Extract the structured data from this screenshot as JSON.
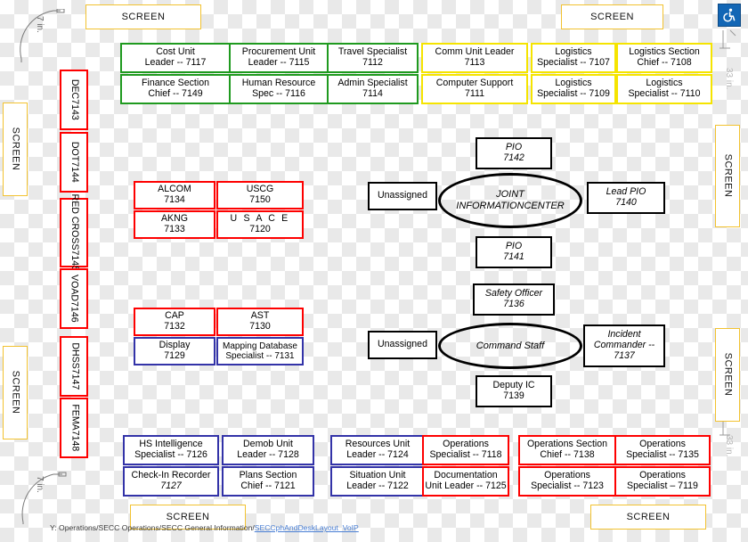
{
  "document": {
    "footer_path": "Y: Operations/SECC Operations/SECC General Information/",
    "footer_link": "SECCphAndDeskLayout_VoIP"
  },
  "colors": {
    "green": "#1f9a1f",
    "yellow": "#f5e400",
    "red": "#fe0000",
    "navy": "#3333a8",
    "black": "#000000",
    "screen_border": "#f2c230",
    "link": "#4a7fd4",
    "accessibility_blue": "#1266b5"
  },
  "screens": {
    "top_left": "SCREEN",
    "top_right": "SCREEN",
    "bottom_center": "SCREEN",
    "bottom_right": "SCREEN",
    "left_upper": "SCREEN",
    "left_lower": "SCREEN",
    "right_upper": "SCREEN",
    "right_lower": "SCREEN"
  },
  "dimensions": {
    "top_left": "7 in.",
    "bottom_left": "7 in.",
    "right_upper": "33 in.",
    "right_lower": "33 in."
  },
  "icons": {
    "accessibility": "wheelchair-accessible-icon"
  },
  "finance_section": {
    "border_color": "#1f9a1f",
    "boxes": [
      {
        "line1": "Cost Unit",
        "line2": "Leader -- 7117"
      },
      {
        "line1": "Procurement Unit",
        "line2": "Leader -- 7115"
      },
      {
        "line1": "Travel Specialist",
        "line2": "7112"
      },
      {
        "line1": "Finance Section",
        "line2": "Chief -- 7149"
      },
      {
        "line1": "Human Resource",
        "line2": "Spec -- 7116"
      },
      {
        "line1": "Admin Specialist",
        "line2": "7114"
      }
    ]
  },
  "logistics_section": {
    "border_color": "#f5e400",
    "boxes": [
      {
        "line1": "Comm Unit Leader",
        "line2": "7113"
      },
      {
        "line1": "Logistics",
        "line2": "Specialist -- 7107"
      },
      {
        "line1": "Logistics Section",
        "line2": "Chief -- 7108"
      },
      {
        "line1": "Computer Support",
        "line2": "7111"
      },
      {
        "line1": "Logistics",
        "line2": "Specialist -- 7109"
      },
      {
        "line1": "Logistics",
        "line2": "Specialist -- 7110"
      }
    ]
  },
  "agency_column": {
    "border_color": "#fe0000",
    "boxes": [
      {
        "line1": "DEC",
        "line2": "7143"
      },
      {
        "line1": "DOT",
        "line2": "7144"
      },
      {
        "line1": "RED CROSS",
        "line2": "7145"
      },
      {
        "line1": "VOAD",
        "line2": "7146"
      },
      {
        "line1": "DHSS",
        "line2": "7147"
      },
      {
        "line1": "FEMA",
        "line2": "7148"
      }
    ]
  },
  "agency_group_upper": {
    "border_color": "#fe0000",
    "boxes": [
      {
        "line1": "ALCOM",
        "line2": "7134"
      },
      {
        "line1": "USCG",
        "line2": "7150"
      },
      {
        "line1": "AKNG",
        "line2": "7133"
      },
      {
        "line1": "U S A C E",
        "line2": "7120"
      }
    ]
  },
  "agency_group_lower": {
    "boxes": [
      {
        "line1": "CAP",
        "line2": "7132",
        "border_color": "#fe0000"
      },
      {
        "line1": "AST",
        "line2": "7130",
        "border_color": "#fe0000"
      },
      {
        "line1": "Display",
        "line2": "7129",
        "border_color": "#3333a8"
      },
      {
        "line1": "Mapping Database",
        "line2": "Specialist -- 7131",
        "border_color": "#3333a8"
      }
    ]
  },
  "joint_information_center": {
    "hub_line1": "JOINT INFORMATION",
    "hub_line2": "CENTER",
    "top": {
      "line1": "PIO",
      "line2": "7142"
    },
    "bottom": {
      "line1": "PIO",
      "line2": "7141"
    },
    "left": {
      "line1": "Unassigned",
      "line2": ""
    },
    "right": {
      "line1": "Lead PIO",
      "line2": "7140"
    }
  },
  "command_staff": {
    "hub_line1": "Command Staff",
    "top": {
      "line1": "Safety Officer",
      "line2": "7136"
    },
    "bottom": {
      "line1": "Deputy IC",
      "line2": "7139"
    },
    "left": {
      "line1": "Unassigned",
      "line2": ""
    },
    "right": {
      "line1": "Incident",
      "line2": "Commander --",
      "line3": "7137"
    }
  },
  "plans_section": {
    "border_color": "#3333a8",
    "boxes": [
      {
        "line1": "HS Intelligence",
        "line2": "Specialist -- 7126"
      },
      {
        "line1": "Demob Unit",
        "line2": "Leader -- 7128"
      },
      {
        "line1": "Check-In Recorder",
        "line2": "7127"
      },
      {
        "line1": "Plans Section",
        "line2": "Chief -- 7121"
      },
      {
        "line1": "Resources Unit",
        "line2": "Leader -- 7124"
      },
      {
        "line1": "Situation Unit",
        "line2": "Leader -- 7122"
      }
    ]
  },
  "operations_section": {
    "border_color": "#fe0000",
    "boxes": [
      {
        "line1": "Operations",
        "line2": "Specialist -- 7118"
      },
      {
        "line1": "Operations Section",
        "line2": "Chief -- 7138"
      },
      {
        "line1": "Operations",
        "line2": "Specialist -- 7135"
      },
      {
        "line1": "Documentation",
        "line2": "Unit Leader -- 7125"
      },
      {
        "line1": "Operations",
        "line2": "Specialist -- 7123"
      },
      {
        "line1": "Operations",
        "line2": "Specialist – 7119"
      }
    ]
  }
}
